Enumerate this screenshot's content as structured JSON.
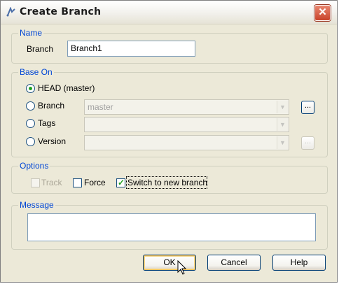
{
  "window": {
    "title": "Create Branch",
    "close_glyph": "✕"
  },
  "name_group": {
    "legend": "Name",
    "branch_label": "Branch",
    "branch_value": "Branch1"
  },
  "base_on": {
    "legend": "Base On",
    "options": [
      {
        "label": "HEAD (master)",
        "checked": true
      },
      {
        "label": "Branch",
        "checked": false,
        "combo_value": "master"
      },
      {
        "label": "Tags",
        "checked": false,
        "combo_value": ""
      },
      {
        "label": "Version",
        "checked": false,
        "combo_value": ""
      }
    ],
    "browse_label": "..."
  },
  "options_group": {
    "legend": "Options",
    "track_label": "Track",
    "force_label": "Force",
    "switch_label": "Switch to new branch",
    "switch_checked": true
  },
  "message_group": {
    "legend": "Message",
    "value": ""
  },
  "buttons": {
    "ok": "OK",
    "cancel": "Cancel",
    "help": "Help"
  },
  "icons": {
    "combo_arrow": "▼",
    "check": "✓"
  },
  "colors": {
    "legend_blue": "#0046d5",
    "radio_green": "#21a121",
    "dialog_bg": "#ece9d8"
  }
}
